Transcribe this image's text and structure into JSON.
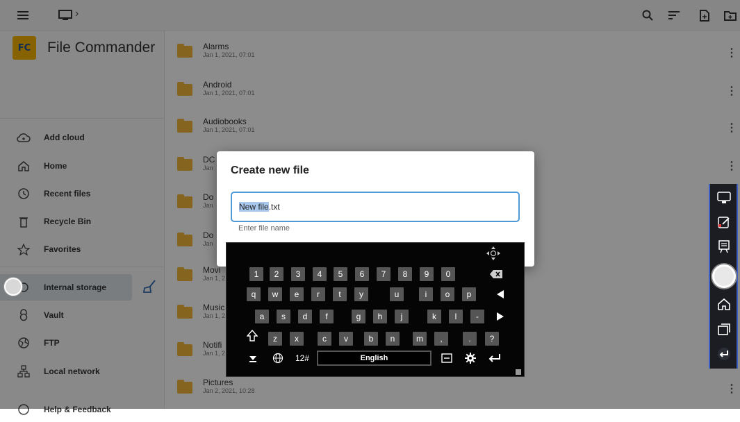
{
  "topbar": {
    "menu_icon": "hamburger-icon",
    "device_icon": "monitor-icon",
    "breadcrumb_sep": "›",
    "actions": [
      "search-icon",
      "sort-icon",
      "new-file-icon",
      "new-folder-icon"
    ]
  },
  "brand": {
    "logo_text": "FC",
    "name": "File Commander"
  },
  "sidebar": {
    "items": [
      {
        "label": "Add cloud",
        "icon": "cloud-add-icon"
      },
      {
        "label": "Home",
        "icon": "home-icon"
      },
      {
        "label": "Recent files",
        "icon": "clock-icon"
      },
      {
        "label": "Recycle Bin",
        "icon": "trash-icon"
      },
      {
        "label": "Favorites",
        "icon": "star-icon"
      },
      {
        "label": "Internal storage",
        "icon": "storage-icon"
      },
      {
        "label": "Vault",
        "icon": "lock-icon"
      },
      {
        "label": "FTP",
        "icon": "globe-icon"
      },
      {
        "label": "Local network",
        "icon": "network-icon"
      },
      {
        "label": "Help & Feedback",
        "icon": "help-icon"
      }
    ]
  },
  "files": [
    {
      "name": "Alarms",
      "date": "Jan 1, 2021, 07:01"
    },
    {
      "name": "Android",
      "date": "Jan 1, 2021, 07:01"
    },
    {
      "name": "Audiobooks",
      "date": "Jan 1, 2021, 07:01"
    },
    {
      "name": "DC",
      "date": "Jan"
    },
    {
      "name": "Do",
      "date": "Jan"
    },
    {
      "name": "Do",
      "date": "Jan"
    },
    {
      "name": "Movi",
      "date": "Jan 1, 2"
    },
    {
      "name": "Music",
      "date": "Jan 1, 2"
    },
    {
      "name": "Notifi",
      "date": "Jan 1, 2"
    },
    {
      "name": "Pictures",
      "date": "Jan 2, 2021, 10:28"
    }
  ],
  "dialog": {
    "title": "Create new file",
    "value_selected": "New file",
    "value_rest": ".txt",
    "hint": "Enter file name"
  },
  "keyboard": {
    "row1": [
      "1",
      "2",
      "3",
      "4",
      "5",
      "6",
      "7",
      "8",
      "9",
      "0"
    ],
    "row2": [
      "q",
      "w",
      "e",
      "r",
      "t",
      "y",
      "u",
      "i",
      "o",
      "p"
    ],
    "row3": [
      "a",
      "s",
      "d",
      "f",
      "g",
      "h",
      "j",
      "k",
      "l",
      "-"
    ],
    "row4": [
      "z",
      "x",
      "c",
      "v",
      "b",
      "n",
      "m",
      ",",
      ".",
      "?"
    ],
    "num_label": "12#",
    "language": "English"
  }
}
